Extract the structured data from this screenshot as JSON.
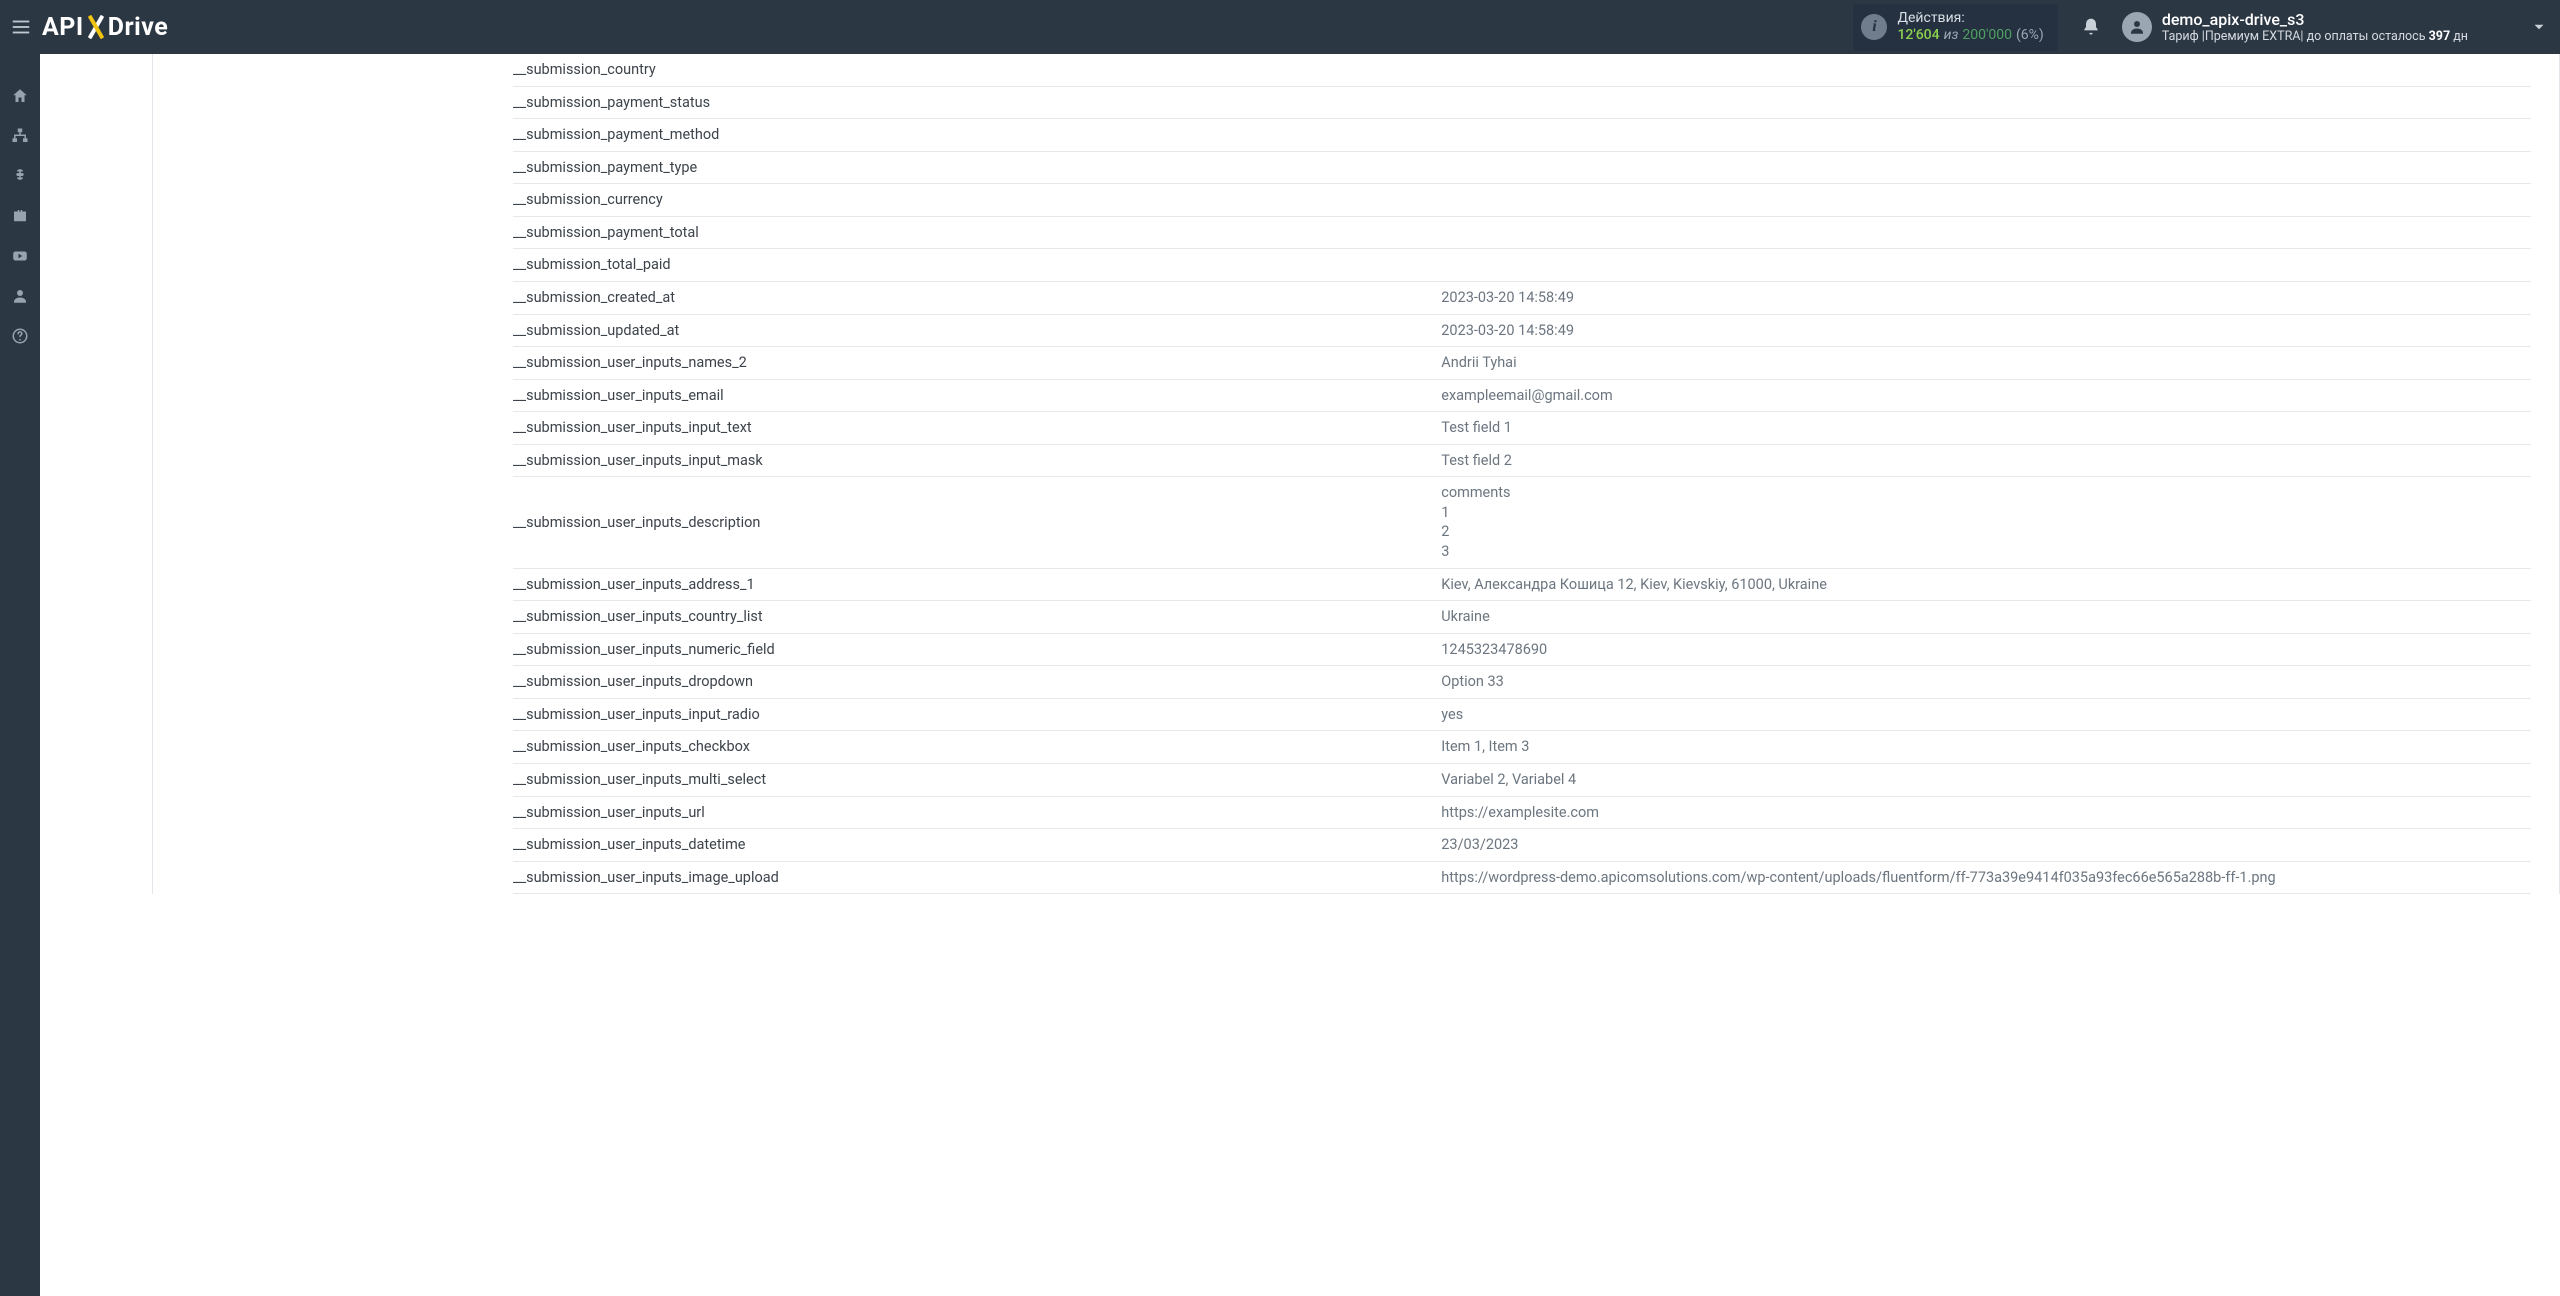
{
  "header": {
    "actions_label": "Действия:",
    "actions_count": "12'604",
    "actions_sep": "из",
    "actions_limit": "200'000",
    "actions_pct": "(6%)",
    "username": "demo_apix-drive_s3",
    "plan_prefix": "Тариф |Премиум EXTRA| до оплаты осталось ",
    "plan_days": "397",
    "plan_suffix": " дн"
  },
  "rows": [
    {
      "k": "__submission_country",
      "v": ""
    },
    {
      "k": "__submission_payment_status",
      "v": ""
    },
    {
      "k": "__submission_payment_method",
      "v": ""
    },
    {
      "k": "__submission_payment_type",
      "v": ""
    },
    {
      "k": "__submission_currency",
      "v": ""
    },
    {
      "k": "__submission_payment_total",
      "v": ""
    },
    {
      "k": "__submission_total_paid",
      "v": ""
    },
    {
      "k": "__submission_created_at",
      "v": "2023-03-20 14:58:49"
    },
    {
      "k": "__submission_updated_at",
      "v": "2023-03-20 14:58:49"
    },
    {
      "k": "__submission_user_inputs_names_2",
      "v": "Andrii Tyhai"
    },
    {
      "k": "__submission_user_inputs_email",
      "v": "exampleemail@gmail.com"
    },
    {
      "k": "__submission_user_inputs_input_text",
      "v": "Test field 1"
    },
    {
      "k": "__submission_user_inputs_input_mask",
      "v": "Test field 2"
    },
    {
      "k": "__submission_user_inputs_description",
      "v": "comments\n1\n2\n3"
    },
    {
      "k": "__submission_user_inputs_address_1",
      "v": "Kiev, Александра Кошица 12, Kiev, Kievskiy, 61000, Ukraine"
    },
    {
      "k": "__submission_user_inputs_country_list",
      "v": "Ukraine"
    },
    {
      "k": "__submission_user_inputs_numeric_field",
      "v": "1245323478690"
    },
    {
      "k": "__submission_user_inputs_dropdown",
      "v": "Option 33"
    },
    {
      "k": "__submission_user_inputs_input_radio",
      "v": "yes"
    },
    {
      "k": "__submission_user_inputs_checkbox",
      "v": "Item 1, Item 3"
    },
    {
      "k": "__submission_user_inputs_multi_select",
      "v": "Variabel 2, Variabel 4"
    },
    {
      "k": "__submission_user_inputs_url",
      "v": "https://examplesite.com"
    },
    {
      "k": "__submission_user_inputs_datetime",
      "v": "23/03/2023"
    },
    {
      "k": "__submission_user_inputs_image_upload",
      "v": "https://wordpress-demo.apicomsolutions.com/wp-content/uploads/fluentform/ff-773a39e9414f035a93fec66e565a288b-ff-1.png"
    }
  ]
}
